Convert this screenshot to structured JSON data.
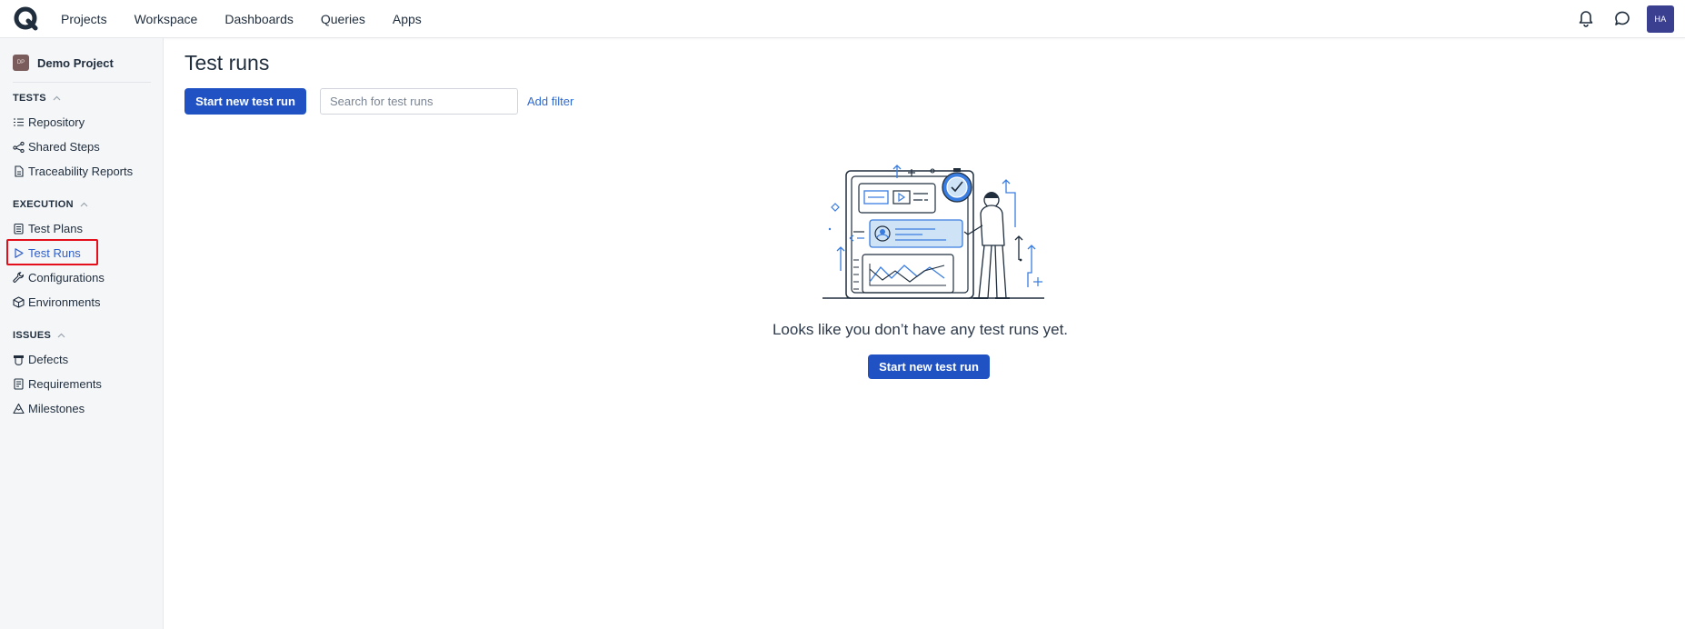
{
  "topbar": {
    "nav": [
      "Projects",
      "Workspace",
      "Dashboards",
      "Queries",
      "Apps"
    ],
    "avatar_initials": "HA"
  },
  "sidebar": {
    "project_icon_text": "DP",
    "project_name": "Demo Project",
    "sections": [
      {
        "title": "TESTS",
        "items": [
          "Repository",
          "Shared Steps",
          "Traceability Reports"
        ]
      },
      {
        "title": "EXECUTION",
        "items": [
          "Test Plans",
          "Test Runs",
          "Configurations",
          "Environments"
        ]
      },
      {
        "title": "ISSUES",
        "items": [
          "Defects",
          "Requirements",
          "Milestones"
        ]
      }
    ],
    "active_item": "Test Runs"
  },
  "main": {
    "title": "Test runs",
    "start_button": "Start new test run",
    "search_placeholder": "Search for test runs",
    "add_filter": "Add filter",
    "empty_message": "Looks like you don’t have any test runs yet.",
    "empty_button": "Start new test run"
  },
  "colors": {
    "primary": "#2152c4",
    "link": "#2f6ad1",
    "active": "#2f5fc8",
    "highlight": "#e3101c",
    "avatar": "#3b3f8f"
  }
}
